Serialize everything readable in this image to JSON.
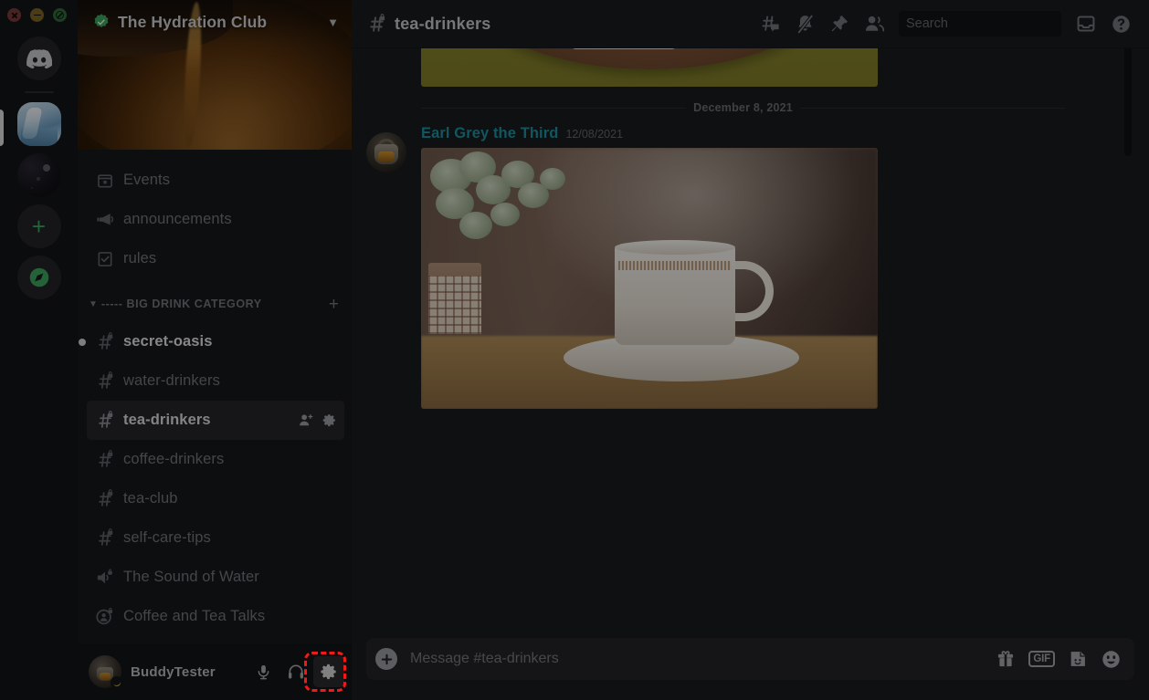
{
  "window": {
    "controls": [
      "close",
      "minimize",
      "maximize"
    ]
  },
  "server_rail": {
    "items": [
      {
        "name": "home",
        "label": "Discord",
        "icon": "discord-logo-icon",
        "selected": false
      },
      {
        "name": "the-hydration-club",
        "label": "The Hydration Club",
        "icon": "water-pour-icon",
        "selected": true
      },
      {
        "name": "dark-server",
        "label": "Server",
        "icon": "microphone-photo-icon",
        "selected": false
      },
      {
        "name": "add-server",
        "label": "Add a Server",
        "icon": "plus-icon",
        "selected": false
      },
      {
        "name": "explore",
        "label": "Explore Public Servers",
        "icon": "compass-icon",
        "selected": false
      }
    ]
  },
  "sidebar": {
    "server_name": "The Hydration Club",
    "verified_badge": "verified-check-icon",
    "dropdown_icon": "chevron-down-icon",
    "top_items": [
      {
        "label": "Events",
        "icon": "calendar-icon"
      },
      {
        "label": "announcements",
        "icon": "megaphone-icon"
      },
      {
        "label": "rules",
        "icon": "rules-checkbox-icon"
      }
    ],
    "category": {
      "label": "----- BIG DRINK CATEGORY",
      "collapse_icon": "chevron-down-icon",
      "add_icon": "plus-icon"
    },
    "channels": [
      {
        "label": "secret-oasis",
        "icon": "hash-locked-icon",
        "state": "unread"
      },
      {
        "label": "water-drinkers",
        "icon": "hash-locked-icon",
        "state": "normal"
      },
      {
        "label": "tea-drinkers",
        "icon": "hash-locked-icon",
        "state": "active",
        "actions": [
          "invite-person-icon",
          "gear-icon"
        ]
      },
      {
        "label": "coffee-drinkers",
        "icon": "hash-locked-icon",
        "state": "normal"
      },
      {
        "label": "tea-club",
        "icon": "hash-locked-icon",
        "state": "normal"
      },
      {
        "label": "self-care-tips",
        "icon": "hash-locked-icon",
        "state": "normal"
      },
      {
        "label": "The Sound of Water",
        "icon": "speaker-locked-icon",
        "state": "normal"
      },
      {
        "label": "Coffee and Tea Talks",
        "icon": "stage-locked-icon",
        "state": "normal"
      }
    ]
  },
  "user_panel": {
    "username": "BuddyTester",
    "status": "idle",
    "avatar": "teapot-avatar",
    "buttons": [
      {
        "name": "mute-button",
        "icon": "microphone-icon",
        "highlighted": false
      },
      {
        "name": "deafen-button",
        "icon": "headphones-icon",
        "highlighted": false
      },
      {
        "name": "user-settings-button",
        "icon": "gear-icon",
        "highlighted": true
      }
    ],
    "highlight_color": "#f51818"
  },
  "topbar": {
    "channel_icon": "hash-locked-icon",
    "channel_name": "tea-drinkers",
    "actions": [
      {
        "name": "threads-button",
        "icon": "threads-icon"
      },
      {
        "name": "notification-settings-button",
        "icon": "bell-slash-icon"
      },
      {
        "name": "pinned-messages-button",
        "icon": "pin-icon"
      },
      {
        "name": "member-list-button",
        "icon": "members-icon"
      }
    ],
    "search": {
      "placeholder": "Search",
      "value": "",
      "icon": "search-icon"
    },
    "right_actions": [
      {
        "name": "inbox-button",
        "icon": "inbox-icon"
      },
      {
        "name": "help-button",
        "icon": "help-circle-icon"
      }
    ]
  },
  "messages": {
    "top_attachment": {
      "name": "tea-set-tray-illustration",
      "alt": "Anime illustration of a tea set on a wooden tray with lemon slices"
    },
    "date_divider": "December 8, 2021",
    "items": [
      {
        "author": "Earl Grey the Third",
        "author_color": "#1e8f9e",
        "timestamp": "12/08/2021",
        "avatar": "teapot-avatar",
        "attachment": {
          "name": "white-teacup-photo",
          "alt": "White teacup and saucer on a wooden table next to a potted plant"
        }
      }
    ]
  },
  "composer": {
    "placeholder": "Message #tea-drinkers",
    "value": "",
    "add_icon": "plus-circle-icon",
    "actions": [
      {
        "name": "gift-button",
        "icon": "gift-icon",
        "label": ""
      },
      {
        "name": "gif-button",
        "icon": "gif-icon",
        "label": "GIF"
      },
      {
        "name": "sticker-button",
        "icon": "sticker-icon",
        "label": ""
      },
      {
        "name": "emoji-button",
        "icon": "emoji-icon",
        "label": ""
      }
    ]
  }
}
